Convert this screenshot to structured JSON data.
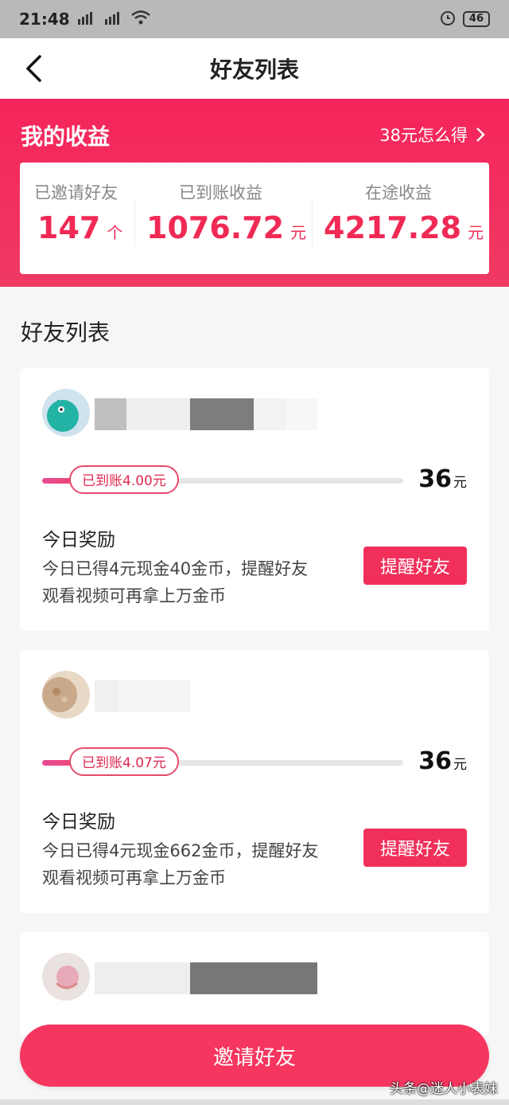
{
  "status_bar": {
    "time": "21:48",
    "signal_1": "H",
    "signal_2": "2G",
    "battery": "46"
  },
  "nav": {
    "title": "好友列表"
  },
  "earnings": {
    "title": "我的收益",
    "link": "38元怎么得",
    "stats": [
      {
        "label": "已邀请好友",
        "value": "147",
        "unit": "个"
      },
      {
        "label": "已到账收益",
        "value": "1076.72",
        "unit": "元"
      },
      {
        "label": "在途收益",
        "value": "4217.28",
        "unit": "元"
      }
    ]
  },
  "section_title": "好友列表",
  "friends": [
    {
      "credited": "已到账4.00元",
      "progress": 0.11,
      "amount": "36",
      "amount_unit": "元",
      "reward_title": "今日奖励",
      "reward_line1": "今日已得4元现金40金币，提醒好友",
      "reward_line2": "观看视频可再拿上万金币",
      "button": "提醒好友"
    },
    {
      "credited": "已到账4.07元",
      "progress": 0.11,
      "amount": "36",
      "amount_unit": "元",
      "reward_title": "今日奖励",
      "reward_line1": "今日已得4元现金662金币，提醒好友",
      "reward_line2": "观看视频可再拿上万金币",
      "button": "提醒好友"
    }
  ],
  "invite_button": "邀请好友",
  "watermark": "头条@迷人小表妹",
  "colors": {
    "primary": "#f0305a",
    "header": "#f5245b"
  },
  "icons": {
    "back": "chevron-left-icon",
    "link_arrow": "chevron-right-icon"
  }
}
